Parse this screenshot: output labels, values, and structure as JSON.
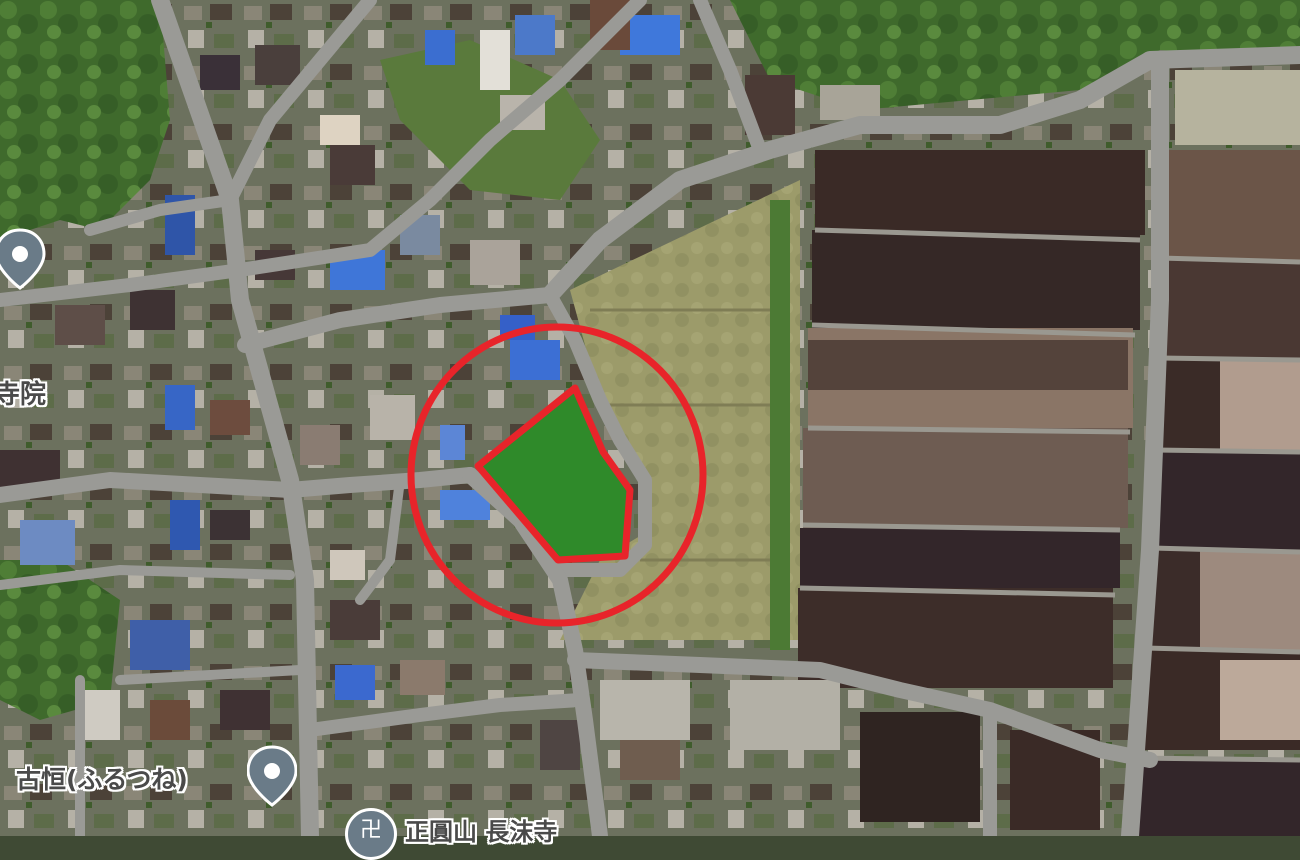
{
  "map": {
    "view": "satellite",
    "highlight_color": "#e8242a",
    "road_color": "#9a9a96",
    "labels": [
      {
        "id": "temple",
        "text": "寺院"
      },
      {
        "id": "furutsune",
        "text": "古恒(ふるつね)"
      },
      {
        "id": "bottom",
        "text": "正圓山 長沫寺"
      }
    ],
    "pins": [
      {
        "id": "pin-left",
        "icon": "map-pin-icon"
      },
      {
        "id": "pin-furutsune",
        "icon": "map-pin-icon"
      },
      {
        "id": "pin-bottom",
        "icon": "temple-marker-icon",
        "glyph": "卍"
      }
    ]
  }
}
